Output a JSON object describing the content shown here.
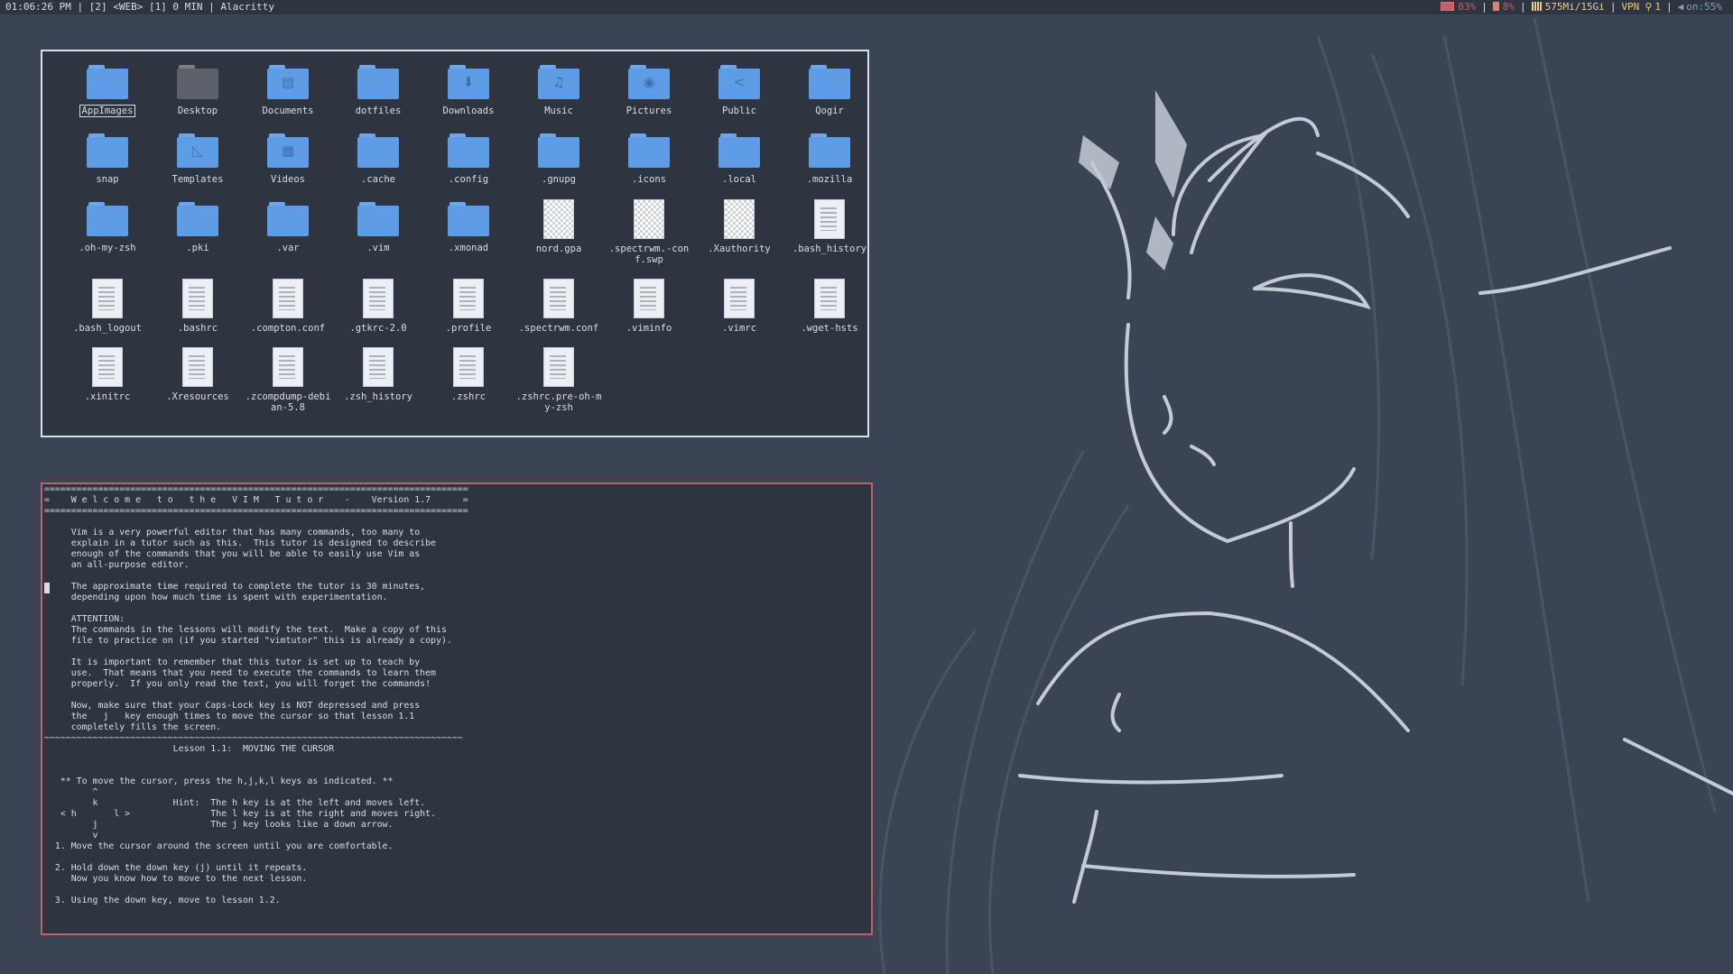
{
  "topbar": {
    "left": "01:06:26 PM | [2] <WEB> [1] 0 MIN | Alacritty",
    "battery": "83%",
    "cpu": "8%",
    "memory": "575Mi/15Gi",
    "vpn": "VPN",
    "key_count": "1",
    "volume": "on:55%",
    "colors": {
      "battery": "#bf616a",
      "cpu": "#d08770",
      "memory": "#ebcb8b",
      "volume": "#81a1c1"
    }
  },
  "filemanager": {
    "items": [
      {
        "name": "AppImages",
        "type": "folder",
        "glyph": ""
      },
      {
        "name": "Desktop",
        "type": "folder-desktop",
        "glyph": ""
      },
      {
        "name": "Documents",
        "type": "folder",
        "glyph": "▤"
      },
      {
        "name": "dotfiles",
        "type": "folder",
        "glyph": ""
      },
      {
        "name": "Downloads",
        "type": "folder",
        "glyph": "⬇"
      },
      {
        "name": "Music",
        "type": "folder",
        "glyph": "♫"
      },
      {
        "name": "Pictures",
        "type": "folder",
        "glyph": "◉"
      },
      {
        "name": "Public",
        "type": "folder",
        "glyph": "<"
      },
      {
        "name": "Qogir",
        "type": "folder",
        "glyph": ""
      },
      {
        "name": "snap",
        "type": "folder",
        "glyph": ""
      },
      {
        "name": "Templates",
        "type": "folder",
        "glyph": "◺"
      },
      {
        "name": "Videos",
        "type": "folder",
        "glyph": "▦"
      },
      {
        "name": ".cache",
        "type": "folder",
        "glyph": ""
      },
      {
        "name": ".config",
        "type": "folder",
        "glyph": ""
      },
      {
        "name": ".gnupg",
        "type": "folder",
        "glyph": ""
      },
      {
        "name": ".icons",
        "type": "folder",
        "glyph": ""
      },
      {
        "name": ".local",
        "type": "folder",
        "glyph": ""
      },
      {
        "name": ".mozilla",
        "type": "folder",
        "glyph": ""
      },
      {
        "name": ".oh-my-zsh",
        "type": "folder",
        "glyph": ""
      },
      {
        "name": ".pki",
        "type": "folder",
        "glyph": ""
      },
      {
        "name": ".var",
        "type": "folder",
        "glyph": ""
      },
      {
        "name": ".vim",
        "type": "folder",
        "glyph": ""
      },
      {
        "name": ".xmonad",
        "type": "folder",
        "glyph": ""
      },
      {
        "name": "nord.gpa",
        "type": "checker"
      },
      {
        "name": ".spectrwm.-conf.swp",
        "type": "checker"
      },
      {
        "name": ".Xauthority",
        "type": "checker"
      },
      {
        "name": ".bash_history",
        "type": "text"
      },
      {
        "name": ".bash_logout",
        "type": "text"
      },
      {
        "name": ".bashrc",
        "type": "text"
      },
      {
        "name": ".compton.conf",
        "type": "text"
      },
      {
        "name": ".gtkrc-2.0",
        "type": "text"
      },
      {
        "name": ".profile",
        "type": "text"
      },
      {
        "name": ".spectrwm.conf",
        "type": "text"
      },
      {
        "name": ".viminfo",
        "type": "text"
      },
      {
        "name": ".vimrc",
        "type": "text"
      },
      {
        "name": ".wget-hsts",
        "type": "text"
      },
      {
        "name": ".xinitrc",
        "type": "text"
      },
      {
        "name": ".Xresources",
        "type": "text"
      },
      {
        "name": ".zcompdump-debian-5.8",
        "type": "text"
      },
      {
        "name": ".zsh_history",
        "type": "text"
      },
      {
        "name": ".zshrc",
        "type": "text"
      },
      {
        "name": ".zshrc.pre-oh-my-zsh",
        "type": "text"
      }
    ]
  },
  "terminal": {
    "lines": [
      "===============================================================================",
      "=    W e l c o m e   t o   t h e   V I M   T u t o r    -    Version 1.7      =",
      "===============================================================================",
      "",
      "     Vim is a very powerful editor that has many commands, too many to",
      "     explain in a tutor such as this.  This tutor is designed to describe",
      "     enough of the commands that you will be able to easily use Vim as",
      "     an all-purpose editor.",
      "",
      "     The approximate time required to complete the tutor is 30 minutes,",
      "     depending upon how much time is spent with experimentation.",
      "",
      "     ATTENTION:",
      "     The commands in the lessons will modify the text.  Make a copy of this",
      "     file to practice on (if you started \"vimtutor\" this is already a copy).",
      "",
      "     It is important to remember that this tutor is set up to teach by",
      "     use.  That means that you need to execute the commands to learn them",
      "     properly.  If you only read the text, you will forget the commands!",
      "",
      "     Now, make sure that your Caps-Lock key is NOT depressed and press",
      "     the   j   key enough times to move the cursor so that lesson 1.1",
      "     completely fills the screen.",
      "~~~~~~~~~~~~~~~~~~~~~~~~~~~~~~~~~~~~~~~~~~~~~~~~~~~~~~~~~~~~~~~~~~~~~~~~~~~~~~",
      "                        Lesson 1.1:  MOVING THE CURSOR",
      "",
      "",
      "   ** To move the cursor, press the h,j,k,l keys as indicated. **",
      "         ^",
      "         k              Hint:  The h key is at the left and moves left.",
      "   < h       l >               The l key is at the right and moves right.",
      "         j                     The j key looks like a down arrow.",
      "         v",
      "  1. Move the cursor around the screen until you are comfortable.",
      "",
      "  2. Hold down the down key (j) until it repeats.",
      "     Now you know how to move to the next lesson.",
      "",
      "  3. Using the down key, move to lesson 1.2."
    ]
  }
}
